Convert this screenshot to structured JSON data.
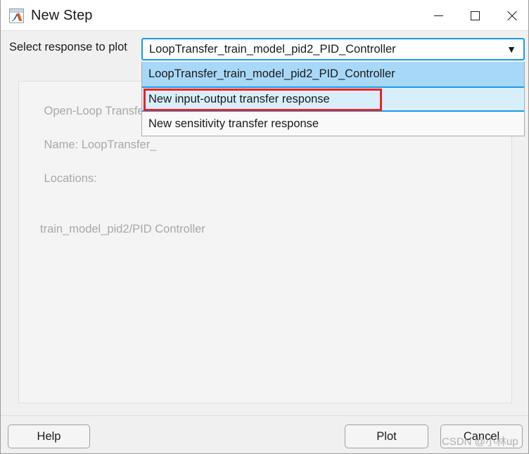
{
  "window": {
    "title": "New Step",
    "icon": "matlab-membrane-icon",
    "controls": {
      "minimize": "minimize-icon",
      "maximize": "maximize-icon",
      "close": "close-icon"
    }
  },
  "form": {
    "select_label": "Select response to plot",
    "combobox": {
      "value": "LoopTransfer_train_model_pid2_PID_Controller",
      "arrow": "▼",
      "options": [
        "LoopTransfer_train_model_pid2_PID_Controller",
        "New input-output transfer response",
        "New sensitivity transfer response"
      ]
    }
  },
  "dropdown": {
    "items": [
      {
        "label": "LoopTransfer_train_model_pid2_PID_Controller",
        "state": "selected"
      },
      {
        "label": "New input-output transfer response",
        "state": "hovered"
      },
      {
        "label": "New sensitivity transfer response",
        "state": "normal"
      }
    ]
  },
  "info_panel": {
    "line1": "Open-Loop Transfer R",
    "line2": "Name: LoopTransfer_",
    "line3": "Locations:",
    "line4": "train_model_pid2/PID Controller"
  },
  "footer": {
    "help_label": "Help",
    "plot_label": "Plot",
    "cancel_label": "Cancel"
  },
  "watermark": {
    "text": "CSDN @小林up"
  },
  "colors": {
    "accent_blue": "#1a9ae8",
    "selected_blue": "#a8d8f8",
    "hover_blue": "#d9eefb",
    "annotation_red": "#ee2222",
    "dialog_bg": "#f0f0f0",
    "panel_bg": "#f4f4f4",
    "disabled_text": "#a8a8a8"
  }
}
